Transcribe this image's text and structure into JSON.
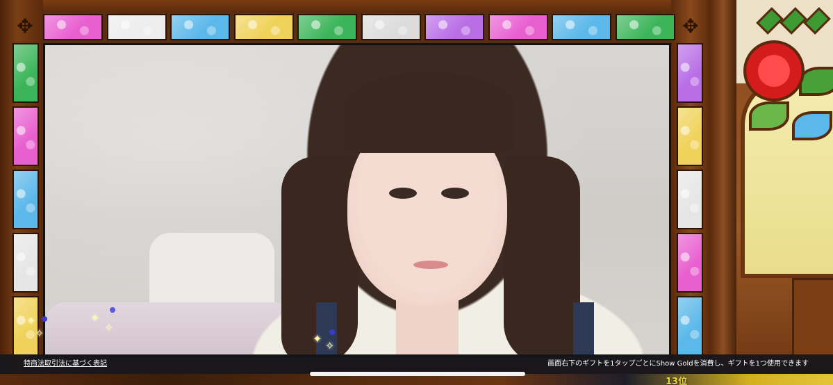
{
  "bottom_bar": {
    "legal_link": "特商法取引法に基づく表記",
    "gift_notice": "画面右下のギフトを1タップごとにShow Goldを消費し、ギフトを1つ使用できます"
  },
  "rank_badge": "13位",
  "frame_top_tile_colors": [
    "#e85fd0",
    "#ededed",
    "#5bb8ea",
    "#f0d25a",
    "#3cb55a",
    "#dcdcdc",
    "#b96ee6",
    "#e85fd0",
    "#5bb8ea",
    "#3cb55a"
  ],
  "frame_left_tile_colors": [
    "#3cb55a",
    "#e85fd0",
    "#5bb8ea",
    "#e6e6e6",
    "#f0d25a"
  ],
  "frame_right_tile_colors": [
    "#b96ee6",
    "#f0d25a",
    "#e6e6e6",
    "#e85fd0",
    "#5bb8ea"
  ],
  "icons": [
    "ornament-icon",
    "sparkle-icon",
    "rose-stained-glass-icon"
  ]
}
